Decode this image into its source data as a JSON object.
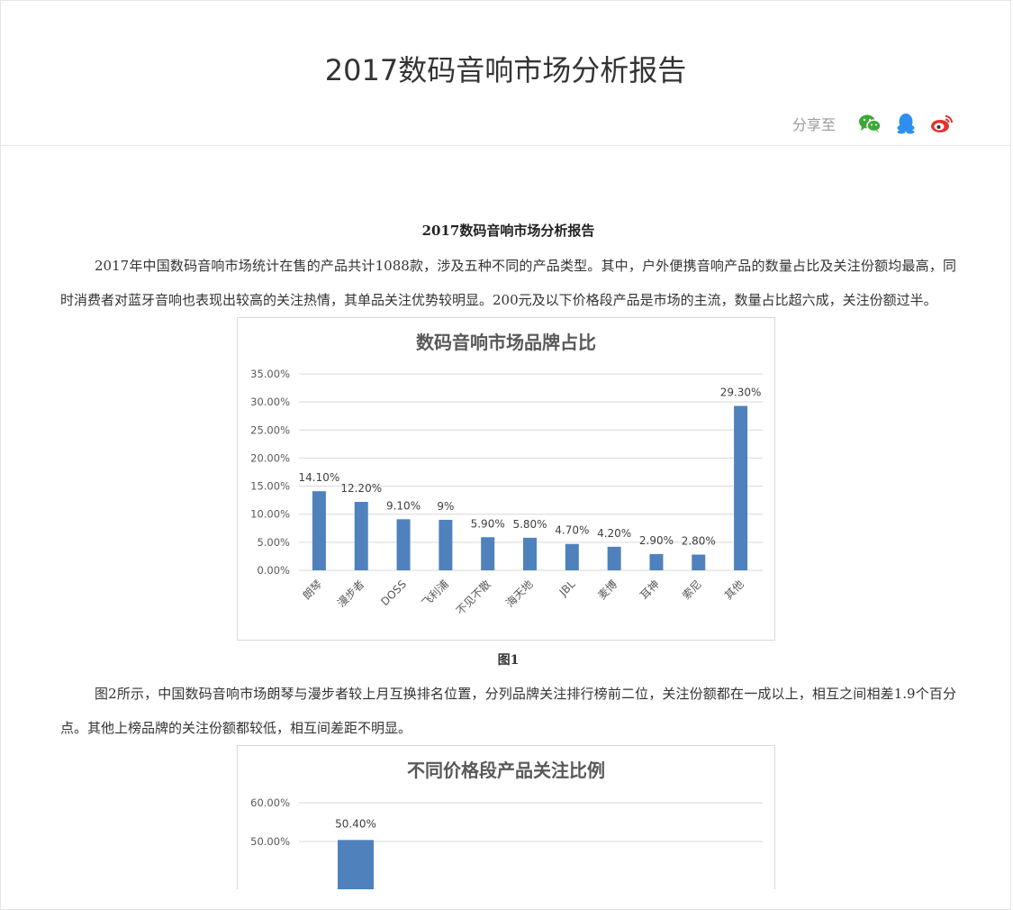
{
  "page": {
    "title": "2017数码音响市场分析报告",
    "share_label": "分享至",
    "share_icons": [
      "wechat-icon",
      "qq-icon",
      "weibo-icon"
    ],
    "colors": {
      "wechat": "#3aaa35",
      "qq": "#2e8ff0",
      "weibo": "#e0342f"
    }
  },
  "article": {
    "heading": "2017数码音响市场分析报告",
    "paragraph1": "2017年中国数码音响市场统计在售的产品共计1088款，涉及五种不同的产品类型。其中，户外便携音响产品的数量占比及关注份额均最高，同时消费者对蓝牙音响也表现出较高的关注热情，其单品关注优势较明显。200元及以下价格段产品是市场的主流，数量占比超六成，关注份额过半。",
    "figure1_caption": "图1",
    "paragraph2": "图2所示，中国数码音响市场朗琴与漫步者较上月互换排名位置，分列品牌关注排行榜前二位，关注份额都在一成以上，相互之间相差1.9个百分点。其他上榜品牌的关注份额都较低，相互间差距不明显。"
  },
  "chart_data": [
    {
      "type": "bar",
      "title": "数码音响市场品牌占比",
      "categories": [
        "朗琴",
        "漫步者",
        "DOSS",
        "飞利浦",
        "不见不散",
        "海天地",
        "JBL",
        "麦博",
        "耳神",
        "索尼",
        "其他"
      ],
      "values": [
        14.1,
        12.2,
        9.1,
        9.0,
        5.9,
        5.8,
        4.7,
        4.2,
        2.9,
        2.8,
        29.3
      ],
      "data_labels": [
        "14.10%",
        "12.20%",
        "9.10%",
        "9%",
        "5.90%",
        "5.80%",
        "4.70%",
        "4.20%",
        "2.90%",
        "2.80%",
        "29.30%"
      ],
      "ylim": [
        0,
        35
      ],
      "yticks": [
        "0.00%",
        "5.00%",
        "10.00%",
        "15.00%",
        "20.00%",
        "25.00%",
        "30.00%",
        "35.00%"
      ],
      "grid": true,
      "color": "#4f81bd"
    },
    {
      "type": "bar",
      "title": "不同价格段产品关注比例",
      "categories": [
        ""
      ],
      "values": [
        50.4
      ],
      "data_labels": [
        "50.40%"
      ],
      "ylim": [
        0,
        60
      ],
      "yticks": [
        "50.00%",
        "60.00%"
      ],
      "grid": true,
      "color": "#4f81bd"
    }
  ]
}
